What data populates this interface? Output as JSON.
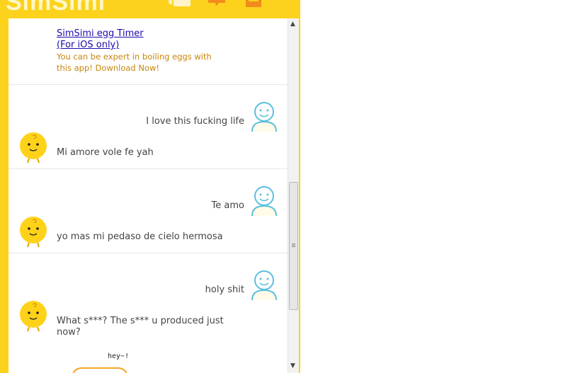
{
  "app": {
    "logo": "SimSimi"
  },
  "header_icons": [
    "chat-icon",
    "alert-icon",
    "menu-icon"
  ],
  "ad": {
    "title_line1": "SimSimi egg Timer",
    "title_line2": "(For iOS only)",
    "description": "You can be expert in boiling eggs with this app! Download Now!"
  },
  "conversations": [
    {
      "user": "I love this fucking life",
      "simsimi": "Mi amore vole fe yah"
    },
    {
      "user": "Te amo",
      "simsimi": "yo mas mi pedaso de cielo hermosa"
    },
    {
      "user": "holy shit",
      "simsimi": "What s***? The s*** u produced just now?"
    }
  ],
  "sticker": {
    "caption": "hey~!"
  },
  "colors": {
    "brand_yellow": "#fcd21c",
    "user_avatar": "#5bc0de",
    "sim_avatar": "#ffd21a",
    "ad_text": "#c8860a",
    "link": "#1a0dab"
  }
}
